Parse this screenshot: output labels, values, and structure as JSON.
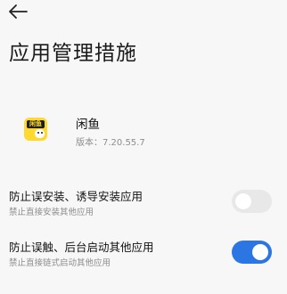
{
  "header": {
    "title": "应用管理措施"
  },
  "app": {
    "name": "闲鱼",
    "version": "版本：7.20.55.7",
    "icon": "xianyu-app-icon",
    "icon_text": "闲鱼"
  },
  "settings": [
    {
      "title": "防止误安装、诱导安装应用",
      "description": "禁止直接安装其他应用",
      "enabled": false
    },
    {
      "title": "防止误触、后台启动其他应用",
      "description": "禁止直接链式启动其他应用",
      "enabled": true
    }
  ],
  "colors": {
    "background": "#f7f7f7",
    "toggle_on": "#2b76e3",
    "toggle_off": "#e8e8e8",
    "secondary_text": "#8d8d8d"
  }
}
